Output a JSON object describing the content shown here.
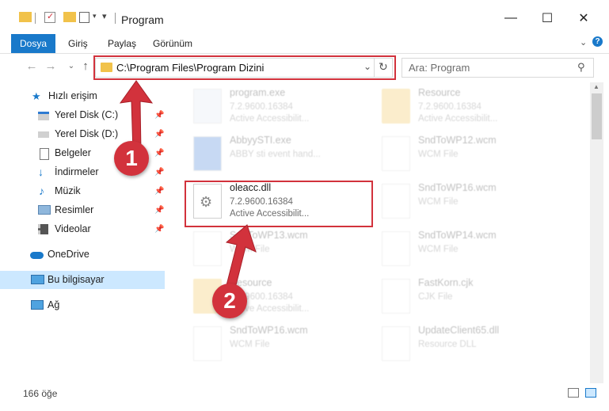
{
  "window": {
    "title": "Program",
    "controls": {
      "minimize": "—",
      "maximize": "☐",
      "close": "✕"
    }
  },
  "ribbon": {
    "tabs": [
      {
        "label": "Dosya"
      },
      {
        "label": "Giriş"
      },
      {
        "label": "Paylaş"
      },
      {
        "label": "Görünüm"
      }
    ]
  },
  "navigation": {
    "address": "C:\\Program Files\\Program Dizini",
    "search_placeholder": "Ara: Program"
  },
  "sidebar": {
    "items": [
      {
        "label": "Hızlı erişim",
        "icon": "star-icon"
      },
      {
        "label": "Yerel Disk (C:)",
        "icon": "drive-icon",
        "pinned": true
      },
      {
        "label": "Yerel Disk (D:)",
        "icon": "drive-icon",
        "pinned": true
      },
      {
        "label": "Belgeler",
        "icon": "documents-icon",
        "pinned": true
      },
      {
        "label": "İndirmeler",
        "icon": "download-icon",
        "pinned": true
      },
      {
        "label": "Müzik",
        "icon": "music-icon",
        "pinned": true
      },
      {
        "label": "Resimler",
        "icon": "pictures-icon",
        "pinned": true
      },
      {
        "label": "Videolar",
        "icon": "videos-icon",
        "pinned": true
      },
      {
        "label": "OneDrive",
        "icon": "cloud-icon"
      },
      {
        "label": "Bu bilgisayar",
        "icon": "computer-icon",
        "selected": true
      },
      {
        "label": "Ağ",
        "icon": "network-icon"
      }
    ]
  },
  "files": [
    {
      "name": "program.exe",
      "line2": "7.2.9600.16384",
      "line3": "Active Accessibilit...",
      "kind": "exe"
    },
    {
      "name": "Resource",
      "line2": "7.2.9600.16384",
      "line3": "Active Accessibilit...",
      "kind": "folder"
    },
    {
      "name": "AbbyySTI.exe",
      "line2": "ABBY sti event hand...",
      "line3": "",
      "kind": "exe"
    },
    {
      "name": "SndToWP12.wcm",
      "line2": "WCM File",
      "line3": "",
      "kind": "doc"
    },
    {
      "name": "oleacc.dll",
      "line2": "7.2.9600.16384",
      "line3": "Active Accessibilit...",
      "kind": "dll"
    },
    {
      "name": "SndToWP16.wcm",
      "line2": "WCM File",
      "line3": "",
      "kind": "doc"
    },
    {
      "name": "SndToWP13.wcm",
      "line2": "WCM File",
      "line3": "",
      "kind": "doc"
    },
    {
      "name": "SndToWP14.wcm",
      "line2": "WCM File",
      "line3": "",
      "kind": "doc"
    },
    {
      "name": "Resource",
      "line2": "7.2.9600.16384",
      "line3": "Active Accessibilit...",
      "kind": "folder"
    },
    {
      "name": "FastKorn.cjk",
      "line2": "CJK File",
      "line3": "",
      "kind": "doc"
    },
    {
      "name": "SndToWP16.wcm",
      "line2": "WCM File",
      "line3": "",
      "kind": "doc"
    },
    {
      "name": "UpdateClient65.dll",
      "line2": "Resource DLL",
      "line3": "",
      "kind": "doc"
    }
  ],
  "status": {
    "count": "166 öğe"
  },
  "annotations": {
    "marker1": "1",
    "marker2": "2"
  },
  "colors": {
    "accent": "#1979ca",
    "highlight": "#d2323c",
    "selected": "#cce8ff"
  }
}
